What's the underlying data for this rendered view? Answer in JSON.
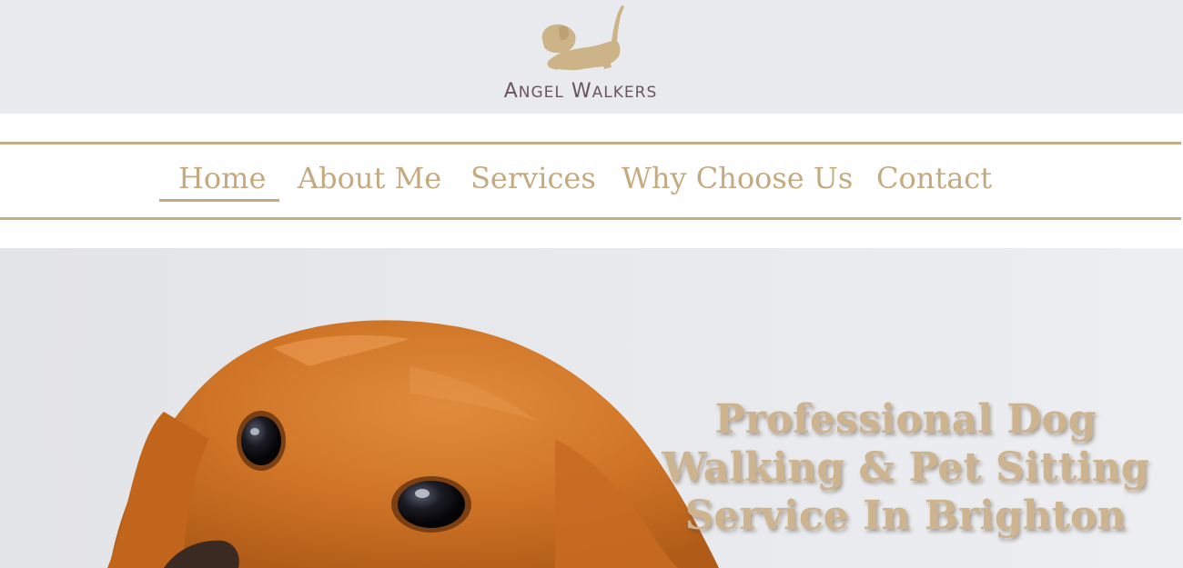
{
  "brand": {
    "logo_icon": "dog-icon",
    "name_first_cap": "A",
    "name_first_rest": "NGEL",
    "name_second_cap": "W",
    "name_second_rest": "ALKERS",
    "colors": {
      "gold": "#c5aa80",
      "plum": "#6a5560",
      "band": "#e9eaee"
    }
  },
  "nav": {
    "items": [
      {
        "label": "Home",
        "active": true
      },
      {
        "label": "About Me",
        "active": false
      },
      {
        "label": "Services",
        "active": false
      },
      {
        "label": "Why Choose Us",
        "active": false
      },
      {
        "label": "Contact",
        "active": false
      }
    ]
  },
  "hero": {
    "title": "Professional Dog Walking & Pet Sitting Service In Brighton",
    "image": "golden-dog-photo"
  }
}
